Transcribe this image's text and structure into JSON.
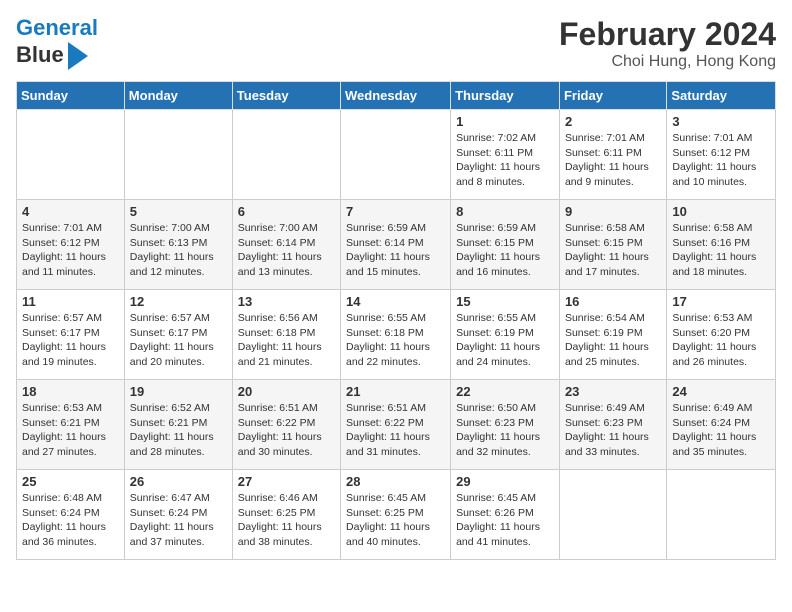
{
  "header": {
    "logo_line1": "General",
    "logo_line2": "Blue",
    "title": "February 2024",
    "subtitle": "Choi Hung, Hong Kong"
  },
  "weekdays": [
    "Sunday",
    "Monday",
    "Tuesday",
    "Wednesday",
    "Thursday",
    "Friday",
    "Saturday"
  ],
  "weeks": [
    [
      {
        "day": "",
        "info": ""
      },
      {
        "day": "",
        "info": ""
      },
      {
        "day": "",
        "info": ""
      },
      {
        "day": "",
        "info": ""
      },
      {
        "day": "1",
        "info": "Sunrise: 7:02 AM\nSunset: 6:11 PM\nDaylight: 11 hours and 8 minutes."
      },
      {
        "day": "2",
        "info": "Sunrise: 7:01 AM\nSunset: 6:11 PM\nDaylight: 11 hours and 9 minutes."
      },
      {
        "day": "3",
        "info": "Sunrise: 7:01 AM\nSunset: 6:12 PM\nDaylight: 11 hours and 10 minutes."
      }
    ],
    [
      {
        "day": "4",
        "info": "Sunrise: 7:01 AM\nSunset: 6:12 PM\nDaylight: 11 hours and 11 minutes."
      },
      {
        "day": "5",
        "info": "Sunrise: 7:00 AM\nSunset: 6:13 PM\nDaylight: 11 hours and 12 minutes."
      },
      {
        "day": "6",
        "info": "Sunrise: 7:00 AM\nSunset: 6:14 PM\nDaylight: 11 hours and 13 minutes."
      },
      {
        "day": "7",
        "info": "Sunrise: 6:59 AM\nSunset: 6:14 PM\nDaylight: 11 hours and 15 minutes."
      },
      {
        "day": "8",
        "info": "Sunrise: 6:59 AM\nSunset: 6:15 PM\nDaylight: 11 hours and 16 minutes."
      },
      {
        "day": "9",
        "info": "Sunrise: 6:58 AM\nSunset: 6:15 PM\nDaylight: 11 hours and 17 minutes."
      },
      {
        "day": "10",
        "info": "Sunrise: 6:58 AM\nSunset: 6:16 PM\nDaylight: 11 hours and 18 minutes."
      }
    ],
    [
      {
        "day": "11",
        "info": "Sunrise: 6:57 AM\nSunset: 6:17 PM\nDaylight: 11 hours and 19 minutes."
      },
      {
        "day": "12",
        "info": "Sunrise: 6:57 AM\nSunset: 6:17 PM\nDaylight: 11 hours and 20 minutes."
      },
      {
        "day": "13",
        "info": "Sunrise: 6:56 AM\nSunset: 6:18 PM\nDaylight: 11 hours and 21 minutes."
      },
      {
        "day": "14",
        "info": "Sunrise: 6:55 AM\nSunset: 6:18 PM\nDaylight: 11 hours and 22 minutes."
      },
      {
        "day": "15",
        "info": "Sunrise: 6:55 AM\nSunset: 6:19 PM\nDaylight: 11 hours and 24 minutes."
      },
      {
        "day": "16",
        "info": "Sunrise: 6:54 AM\nSunset: 6:19 PM\nDaylight: 11 hours and 25 minutes."
      },
      {
        "day": "17",
        "info": "Sunrise: 6:53 AM\nSunset: 6:20 PM\nDaylight: 11 hours and 26 minutes."
      }
    ],
    [
      {
        "day": "18",
        "info": "Sunrise: 6:53 AM\nSunset: 6:21 PM\nDaylight: 11 hours and 27 minutes."
      },
      {
        "day": "19",
        "info": "Sunrise: 6:52 AM\nSunset: 6:21 PM\nDaylight: 11 hours and 28 minutes."
      },
      {
        "day": "20",
        "info": "Sunrise: 6:51 AM\nSunset: 6:22 PM\nDaylight: 11 hours and 30 minutes."
      },
      {
        "day": "21",
        "info": "Sunrise: 6:51 AM\nSunset: 6:22 PM\nDaylight: 11 hours and 31 minutes."
      },
      {
        "day": "22",
        "info": "Sunrise: 6:50 AM\nSunset: 6:23 PM\nDaylight: 11 hours and 32 minutes."
      },
      {
        "day": "23",
        "info": "Sunrise: 6:49 AM\nSunset: 6:23 PM\nDaylight: 11 hours and 33 minutes."
      },
      {
        "day": "24",
        "info": "Sunrise: 6:49 AM\nSunset: 6:24 PM\nDaylight: 11 hours and 35 minutes."
      }
    ],
    [
      {
        "day": "25",
        "info": "Sunrise: 6:48 AM\nSunset: 6:24 PM\nDaylight: 11 hours and 36 minutes."
      },
      {
        "day": "26",
        "info": "Sunrise: 6:47 AM\nSunset: 6:24 PM\nDaylight: 11 hours and 37 minutes."
      },
      {
        "day": "27",
        "info": "Sunrise: 6:46 AM\nSunset: 6:25 PM\nDaylight: 11 hours and 38 minutes."
      },
      {
        "day": "28",
        "info": "Sunrise: 6:45 AM\nSunset: 6:25 PM\nDaylight: 11 hours and 40 minutes."
      },
      {
        "day": "29",
        "info": "Sunrise: 6:45 AM\nSunset: 6:26 PM\nDaylight: 11 hours and 41 minutes."
      },
      {
        "day": "",
        "info": ""
      },
      {
        "day": "",
        "info": ""
      }
    ]
  ]
}
